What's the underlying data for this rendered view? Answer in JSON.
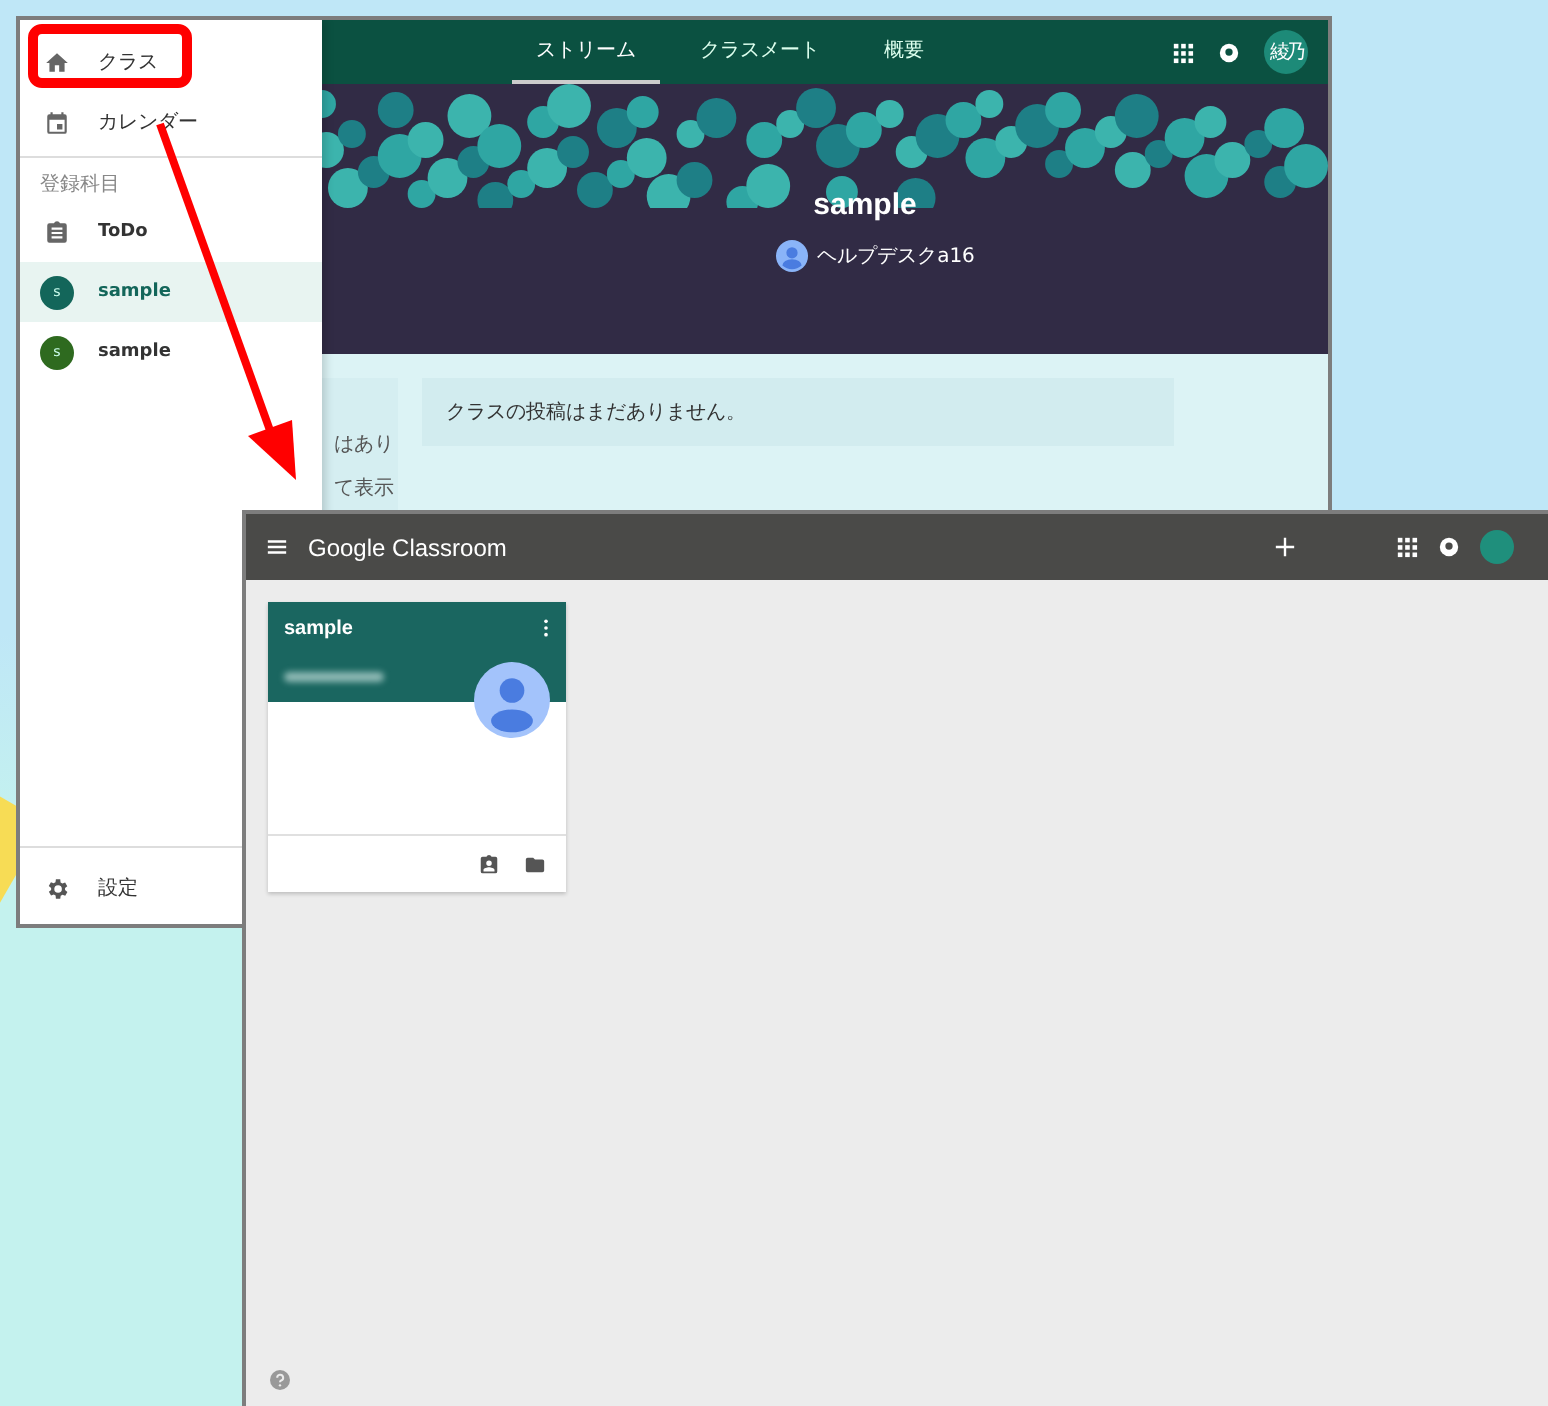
{
  "back_window": {
    "sidebar": {
      "items": [
        {
          "kind": "home",
          "label": "クラス",
          "selected": false
        },
        {
          "kind": "calendar",
          "label": "カレンダー",
          "selected": false
        }
      ],
      "section_heading": "登録科目",
      "enrolled": [
        {
          "kind": "todo",
          "label": "ToDo",
          "selected": false
        },
        {
          "kind": "class",
          "label": "sample",
          "initial": "s",
          "color": "#13665a",
          "selected": true
        },
        {
          "kind": "class",
          "label": "sample",
          "initial": "s",
          "color": "#2e6a1f",
          "selected": false
        }
      ],
      "settings": "設定"
    },
    "tabs": [
      {
        "label": "ストリーム",
        "selected": true
      },
      {
        "label": "クラスメート",
        "selected": false
      },
      {
        "label": "概要",
        "selected": false
      }
    ],
    "avatar_text": "綾乃",
    "banner": {
      "title": "sample",
      "teacher": "ヘルプデスクa16"
    },
    "left_fragments": [
      "はあり",
      "て表示"
    ],
    "empty_message": "クラスの投稿はまだありません。"
  },
  "front_window": {
    "title": "Google Classroom",
    "cards": [
      {
        "title": "sample"
      }
    ]
  }
}
